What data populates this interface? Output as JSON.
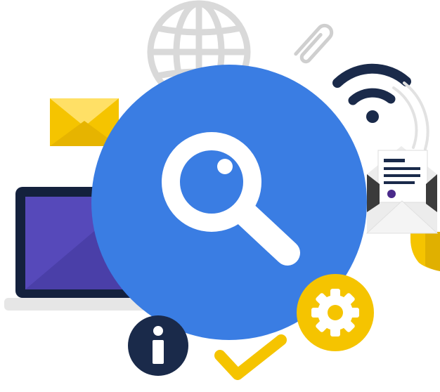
{
  "illustration": {
    "icons": [
      "globe-icon",
      "paperclip-icon",
      "wifi-icon",
      "mail-envelope-icon",
      "laptop-icon",
      "magnifying-glass-icon",
      "open-letter-icon",
      "shield-icon",
      "settings-gear-icon",
      "info-icon",
      "checkmark-icon"
    ],
    "colors": {
      "primary_blue": "#3a7de3",
      "accent_yellow": "#f5c400",
      "navy": "#1a2a4a",
      "light_gray": "#d9d9d9",
      "laptop_screen": "#4a3fa8",
      "white": "#ffffff"
    }
  }
}
